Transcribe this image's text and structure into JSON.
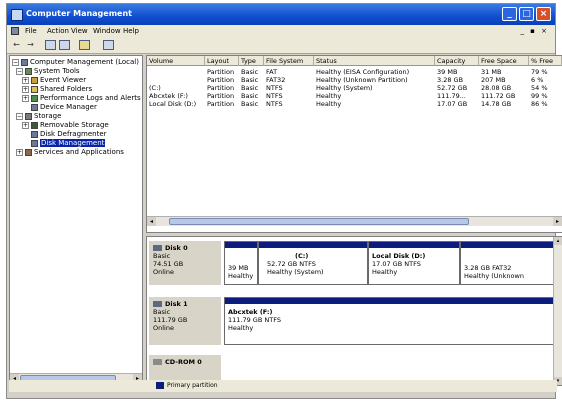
{
  "window": {
    "title": "Computer Management",
    "minimize": "_",
    "maximize": "□",
    "close": "×"
  },
  "menu": {
    "items": [
      "File",
      "Action",
      "View",
      "Window",
      "Help"
    ],
    "mdi": "_ ▪ ×"
  },
  "toolbar": {
    "back": "←",
    "forward": "→"
  },
  "tree": {
    "items": [
      {
        "label": "Computer Management (Local)",
        "expander": "−",
        "level": 0,
        "icon_color": "#6a7a98",
        "selected": false
      },
      {
        "label": "System Tools",
        "expander": "−",
        "level": 1,
        "icon_color": "#6a8a5a",
        "selected": false
      },
      {
        "label": "Event Viewer",
        "expander": "+",
        "level": 2,
        "icon_color": "#c8a040",
        "selected": false
      },
      {
        "label": "Shared Folders",
        "expander": "+",
        "level": 2,
        "icon_color": "#e0c050",
        "selected": false
      },
      {
        "label": "Performance Logs and Alerts",
        "expander": "+",
        "level": 2,
        "icon_color": "#508a50",
        "selected": false
      },
      {
        "label": "Device Manager",
        "expander": "",
        "level": 2,
        "icon_color": "#6a7a98",
        "selected": false
      },
      {
        "label": "Storage",
        "expander": "−",
        "level": 1,
        "icon_color": "#7a7a7a",
        "selected": false
      },
      {
        "label": "Removable Storage",
        "expander": "+",
        "level": 2,
        "icon_color": "#3a5a3a",
        "selected": false
      },
      {
        "label": "Disk Defragmenter",
        "expander": "",
        "level": 2,
        "icon_color": "#6a7a98",
        "selected": false
      },
      {
        "label": "Disk Management",
        "expander": "",
        "level": 2,
        "icon_color": "#6a7a98",
        "selected": true
      },
      {
        "label": "Services and Applications",
        "expander": "+",
        "level": 1,
        "icon_color": "#8a6a4a",
        "selected": false
      }
    ]
  },
  "volume_list": {
    "columns": [
      "Volume",
      "Layout",
      "Type",
      "File System",
      "Status",
      "Capacity",
      "Free Space",
      "% Free"
    ],
    "rows": [
      [
        "",
        "Partition",
        "Basic",
        "FAT",
        "Healthy (EISA Configuration)",
        "39 MB",
        "31 MB",
        "79 %"
      ],
      [
        "",
        "Partition",
        "Basic",
        "FAT32",
        "Healthy (Unknown Partition)",
        "3.28 GB",
        "207 MB",
        "6 %"
      ],
      [
        "(C:)",
        "Partition",
        "Basic",
        "NTFS",
        "Healthy (System)",
        "52.72 GB",
        "28.08 GB",
        "54 %"
      ],
      [
        "Abcxtek (F:)",
        "Partition",
        "Basic",
        "NTFS",
        "Healthy",
        "111.79...",
        "111.72 GB",
        "99 %"
      ],
      [
        "Local Disk (D:)",
        "Partition",
        "Basic",
        "NTFS",
        "Healthy",
        "17.07 GB",
        "14.78 GB",
        "86 %"
      ]
    ]
  },
  "disks": [
    {
      "name": "Disk 0",
      "type": "Basic",
      "size": "74.51 GB",
      "status": "Online",
      "partitions": [
        {
          "name": "",
          "size": "39 MB",
          "status": "Healthy"
        },
        {
          "name": "(C:)",
          "size": "52.72 GB NTFS",
          "status": "Healthy (System)"
        },
        {
          "name": "Local Disk (D:)",
          "size": "17.07 GB NTFS",
          "status": "Healthy"
        },
        {
          "name": "",
          "size": "3.28 GB FAT32",
          "status": "Healthy (Unknown"
        }
      ]
    },
    {
      "name": "Disk 1",
      "type": "Basic",
      "size": "111.79 GB",
      "status": "Online",
      "partitions": [
        {
          "name": "Abcxtek (F:)",
          "size": "111.79 GB NTFS",
          "status": "Healthy"
        }
      ]
    },
    {
      "name": "CD-ROM 0",
      "type": "",
      "size": "",
      "status": "",
      "partitions": []
    }
  ],
  "legend": {
    "primary_label": "Primary partition",
    "primary_color": "#0c1c7c"
  },
  "colors": {
    "titlebar": "#0f4fd0",
    "selection": "#0a24a8",
    "partition_bar": "#0c1c7c"
  }
}
